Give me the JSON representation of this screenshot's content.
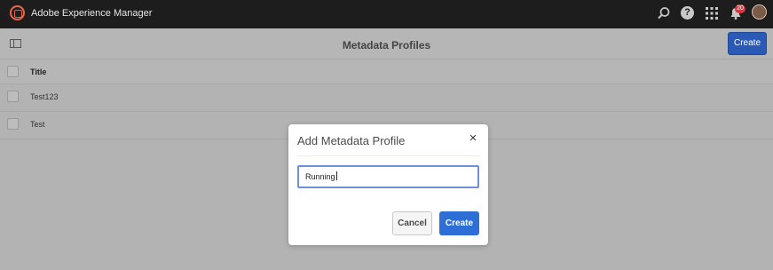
{
  "app": {
    "title": "Adobe Experience Manager"
  },
  "topbar": {
    "search_icon": "search-icon",
    "help_label": "?",
    "notifications_count": "20"
  },
  "actionbar": {
    "page_title": "Metadata Profiles",
    "create_label": "Create"
  },
  "table": {
    "header": "Title",
    "rows": [
      {
        "title": "Test123"
      },
      {
        "title": "Test"
      }
    ]
  },
  "dialog": {
    "title": "Add Metadata Profile",
    "close_label": "×",
    "input_value": "Running",
    "cancel_label": "Cancel",
    "create_label": "Create"
  },
  "colors": {
    "brand": "#2d6fd7",
    "topbar": "#1d1d1d",
    "overlay": "#b3b3b3",
    "badge": "#d7373f"
  }
}
